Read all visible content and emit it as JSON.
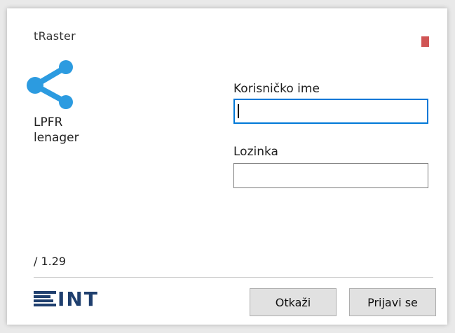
{
  "window": {
    "brand_top": "tRaster",
    "app_name_line1": "LPFR",
    "app_name_line2": "lenager",
    "version": "/ 1.29",
    "logo_text": "INT"
  },
  "form": {
    "username_label": "Korisničko ime",
    "username_value": "",
    "password_label": "Lozinka",
    "password_value": ""
  },
  "buttons": {
    "cancel_label": "Otkaži",
    "login_label": "Prijavi se"
  },
  "colors": {
    "accent": "#0078d7",
    "icon_blue": "#2c9be0",
    "logo_navy": "#1f3f6e",
    "close_red": "#d05555"
  },
  "icons": {
    "app_icon": "share-nodes-icon",
    "close": "close-icon"
  }
}
